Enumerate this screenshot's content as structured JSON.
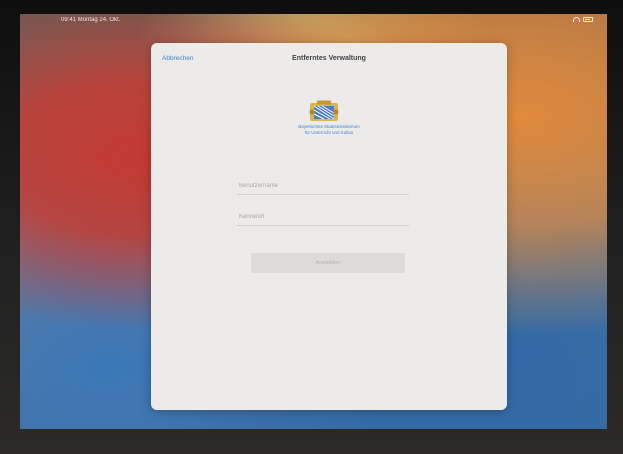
{
  "status_bar": {
    "time_date": "09:41  Montag 24. Okt.",
    "battery_icon": "battery-icon",
    "wifi_icon": "wifi-icon"
  },
  "modal": {
    "cancel_label": "Abbrechen",
    "title": "Entferntes Verwaltung",
    "ministry_line1": "Bayerisches Staatsministerium",
    "ministry_line2": "für Unterricht und Kultus",
    "crest_icon": "bavarian-coat-of-arms-icon",
    "username_placeholder": "Benutzername",
    "password_placeholder": "Kennwort",
    "login_label": "Anmelden"
  },
  "colors": {
    "accent": "#3a86d6",
    "modal_bg": "#ecebea",
    "button_disabled": "#dcdbd9"
  }
}
